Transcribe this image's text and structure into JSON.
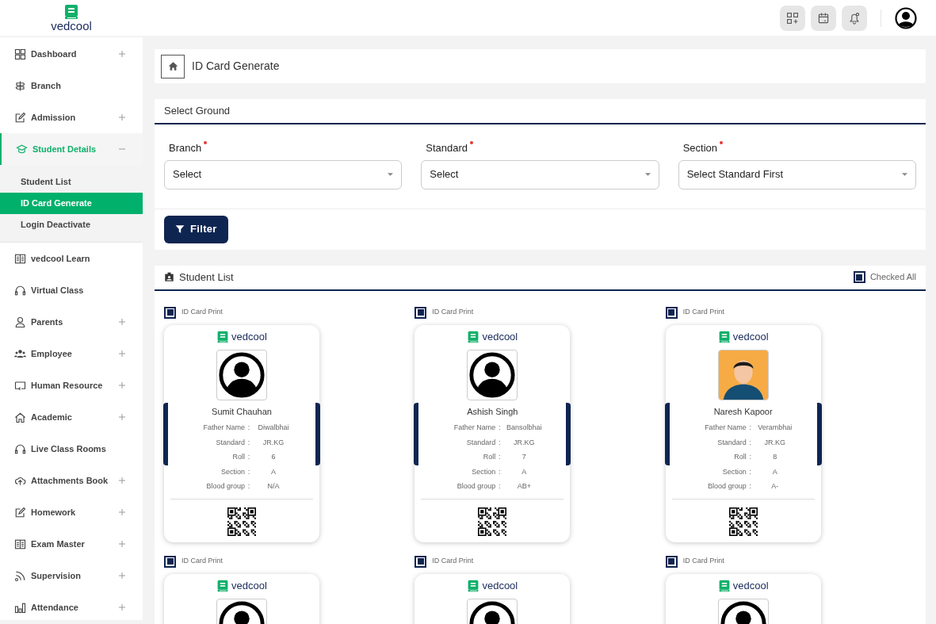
{
  "header": {
    "brand": "vedcool"
  },
  "sidebar": {
    "items": [
      {
        "label": "Dashboard",
        "kind": "expandable",
        "expanded": false
      },
      {
        "label": "Branch",
        "kind": "link"
      },
      {
        "label": "Admission",
        "kind": "expandable",
        "expanded": false
      },
      {
        "label": "Student Details",
        "kind": "expandable",
        "expanded": true,
        "children": [
          {
            "label": "Student List",
            "selected": false
          },
          {
            "label": "ID Card Generate",
            "selected": true
          },
          {
            "label": "Login Deactivate",
            "selected": false
          }
        ]
      },
      {
        "label": "vedcool Learn",
        "kind": "link"
      },
      {
        "label": "Virtual Class",
        "kind": "link"
      },
      {
        "label": "Parents",
        "kind": "expandable",
        "expanded": false
      },
      {
        "label": "Employee",
        "kind": "expandable",
        "expanded": false
      },
      {
        "label": "Human Resource",
        "kind": "expandable",
        "expanded": false
      },
      {
        "label": "Academic",
        "kind": "expandable",
        "expanded": false
      },
      {
        "label": "Live Class Rooms",
        "kind": "link"
      },
      {
        "label": "Attachments Book",
        "kind": "expandable",
        "expanded": false
      },
      {
        "label": "Homework",
        "kind": "expandable",
        "expanded": false
      },
      {
        "label": "Exam Master",
        "kind": "expandable",
        "expanded": false
      },
      {
        "label": "Supervision",
        "kind": "expandable",
        "expanded": false
      },
      {
        "label": "Attendance",
        "kind": "expandable",
        "expanded": false
      }
    ]
  },
  "breadcrumb": {
    "title": "ID Card Generate"
  },
  "filter_panel": {
    "title": "Select Ground",
    "fields": [
      {
        "label": "Branch",
        "required": true,
        "value": "Select"
      },
      {
        "label": "Standard",
        "required": true,
        "value": "Select"
      },
      {
        "label": "Section",
        "required": true,
        "value": "Select Standard First"
      }
    ],
    "button": "Filter"
  },
  "student_list": {
    "title": "Student List",
    "check_all": {
      "label": "Checked All",
      "checked": true
    },
    "cards": [
      {
        "print_label": "ID Card Print",
        "checked": true,
        "brand": "vedcool",
        "kind": "avatar",
        "name": "Sumit Chauhan",
        "details": [
          {
            "label": "Father Name",
            "sep": ":",
            "value": "Diwalbhai"
          },
          {
            "label": "Standard",
            "sep": ":",
            "value": "JR.KG"
          },
          {
            "label": "Roll",
            "sep": ":",
            "value": "6"
          },
          {
            "label": "Section",
            "sep": ":",
            "value": "A"
          },
          {
            "label": "Blood group",
            "sep": ":",
            "value": "N/A"
          }
        ]
      },
      {
        "print_label": "ID Card Print",
        "checked": true,
        "brand": "vedcool",
        "kind": "avatar",
        "name": "Ashish Singh",
        "details": [
          {
            "label": "Father Name",
            "sep": ":",
            "value": "Bansolbhai"
          },
          {
            "label": "Standard",
            "sep": ":",
            "value": "JR.KG"
          },
          {
            "label": "Roll",
            "sep": ":",
            "value": "7"
          },
          {
            "label": "Section",
            "sep": ":",
            "value": "A"
          },
          {
            "label": "Blood group",
            "sep": ":",
            "value": "AB+"
          }
        ]
      },
      {
        "print_label": "ID Card Print",
        "checked": true,
        "brand": "vedcool",
        "kind": "picture",
        "name": "Naresh Kapoor",
        "details": [
          {
            "label": "Father Name",
            "sep": ":",
            "value": "Verambhai"
          },
          {
            "label": "Standard",
            "sep": ":",
            "value": "JR.KG"
          },
          {
            "label": "Roll",
            "sep": ":",
            "value": "8"
          },
          {
            "label": "Section",
            "sep": ":",
            "value": "A"
          },
          {
            "label": "Blood group",
            "sep": ":",
            "value": "A-"
          }
        ]
      },
      {
        "print_label": "ID Card Print",
        "checked": true,
        "brand": "vedcool",
        "kind": "avatar"
      },
      {
        "print_label": "ID Card Print",
        "checked": true,
        "brand": "vedcool",
        "kind": "avatar"
      },
      {
        "print_label": "ID Card Print",
        "checked": true,
        "brand": "vedcool",
        "kind": "avatar"
      }
    ]
  }
}
